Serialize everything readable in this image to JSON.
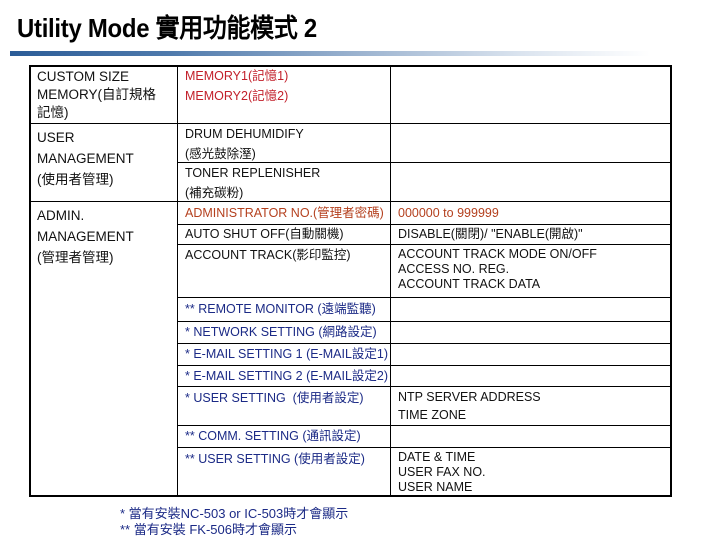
{
  "header": {
    "title": "Utility Mode 實用功能模式 2"
  },
  "colors": {
    "title_bar": "#2b5c97",
    "memory_text": "#c21f2a",
    "admin_no_text": "#b4401e",
    "network_text": "#1b2a86"
  },
  "table": {
    "sections": [
      {
        "label": "CUSTOM SIZE\nMEMORY(自訂規格\n記憶)",
        "rows": [
          {
            "item": "MEMORY1(記憶1)\nMEMORY2(記憶2)",
            "detail": ""
          }
        ]
      },
      {
        "label": "USER\nMANAGEMENT\n(使用者管理)",
        "rows": [
          {
            "item": "DRUM DEHUMIDIFY\n(感光鼓除溼)",
            "detail": ""
          },
          {
            "item": "TONER REPLENISHER\n(補充碳粉)",
            "detail": ""
          }
        ]
      },
      {
        "label": "ADMIN.\nMANAGEMENT\n(管理者管理)",
        "rows": [
          {
            "item": "ADMINISTRATOR NO.(管理者密碼)",
            "detail": "000000 to 999999"
          },
          {
            "item": "AUTO SHUT OFF(自動關機)",
            "detail": "DISABLE(關閉)/ \"ENABLE(開啟)\""
          },
          {
            "item": "ACCOUNT TRACK(影印監控)",
            "detail": "ACCOUNT TRACK MODE ON/OFF\nACCESS NO. REG.\nACCOUNT TRACK DATA"
          },
          {
            "item": "** REMOTE MONITOR (遠端監聽)",
            "detail": ""
          },
          {
            "item": "* NETWORK SETTING (網路設定)",
            "detail": ""
          },
          {
            "item": "* E-MAIL SETTING 1 (E-MAIL設定1)",
            "detail": ""
          },
          {
            "item": "* E-MAIL SETTING 2 (E-MAIL設定2)",
            "detail": ""
          },
          {
            "item": "* USER SETTING  (使用者設定)",
            "detail": "NTP SERVER ADDRESS\nTIME ZONE"
          },
          {
            "item": "** COMM. SETTING (通訊設定)",
            "detail": ""
          },
          {
            "item": "** USER SETTING (使用者設定)",
            "detail": "DATE & TIME\nUSER FAX NO.\nUSER NAME"
          }
        ]
      }
    ]
  },
  "footnotes": [
    "* 當有安裝NC-503 or IC-503時才會顯示",
    "** 當有安裝 FK-506時才會顯示"
  ]
}
